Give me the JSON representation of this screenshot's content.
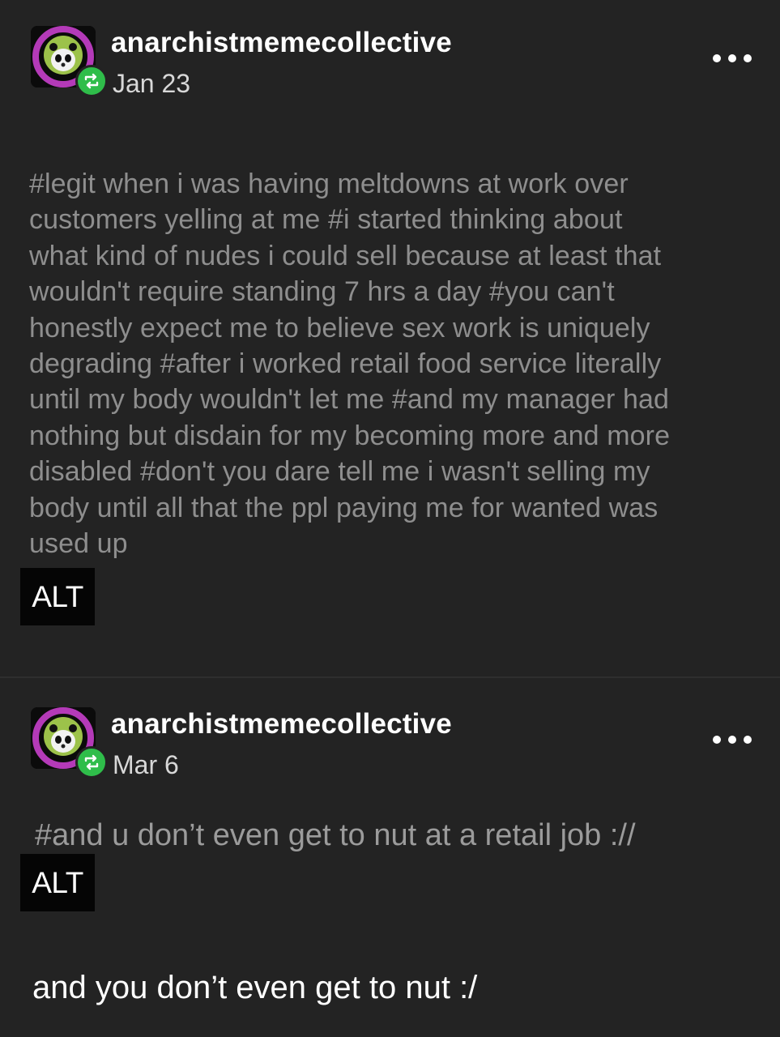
{
  "posts": [
    {
      "username": "anarchistmemecollective",
      "date": "Jan 23",
      "image_tag_lines": [
        "#legit when i was having meltdowns at work over",
        "customers yelling at me  #i started thinking about",
        "what kind of nudes i could sell because at least that",
        "wouldn't require standing 7 hrs a day  #you can't",
        "honestly expect me to believe sex work is uniquely",
        "degrading  #after i worked retail food service literally",
        "until my body wouldn't let me  #and my manager had",
        "nothing but disdain for my becoming more and more",
        "disabled  #don't you dare tell me i wasn't selling my",
        "body until all that the ppl paying me for wanted was",
        "used up"
      ],
      "alt_label": "ALT"
    },
    {
      "username": "anarchistmemecollective",
      "date": "Mar 6",
      "image_tag_text": "#and u don’t even get to nut at a retail job ://",
      "alt_label": "ALT",
      "body_text": "and you don’t even get to nut :/"
    }
  ],
  "icons": {
    "avatar": "avatar-image",
    "reblog": "reblog-icon",
    "more": "more-options-icon"
  },
  "colors": {
    "background": "#232323",
    "reblog_badge": "#2fbd4a",
    "tag_text": "#8e8e8e"
  }
}
